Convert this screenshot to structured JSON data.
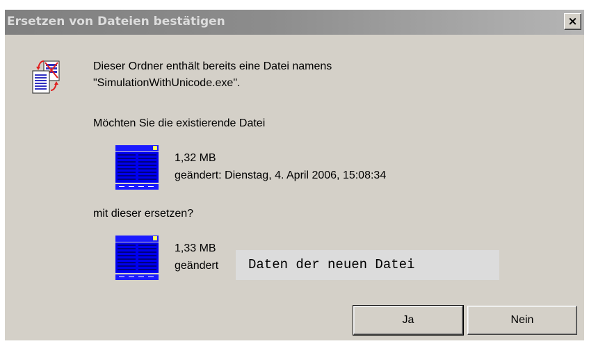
{
  "dialog": {
    "title": "Ersetzen von Dateien bestätigen",
    "close_label": "×"
  },
  "message": {
    "line1": "Dieser Ordner enthält bereits eine Datei namens",
    "line2": "\"SimulationWithUnicode.exe\"."
  },
  "question": "Möchten Sie die existierende Datei",
  "existing_file": {
    "size": "1,32 MB",
    "modified": "geändert: Dienstag, 4. April 2006, 15:08:34"
  },
  "replace_with": "mit dieser ersetzen?",
  "new_file": {
    "size": "1,33 MB",
    "modified": "geändert"
  },
  "tooltip": "Daten der neuen Datei",
  "buttons": {
    "yes": "Ja",
    "no": "Nein"
  },
  "icons": {
    "main": "replace-file-icon",
    "file": "executable-file-icon"
  },
  "colors": {
    "dialog_bg": "#d4d0c8",
    "file_icon_blue": "#0000ff"
  }
}
